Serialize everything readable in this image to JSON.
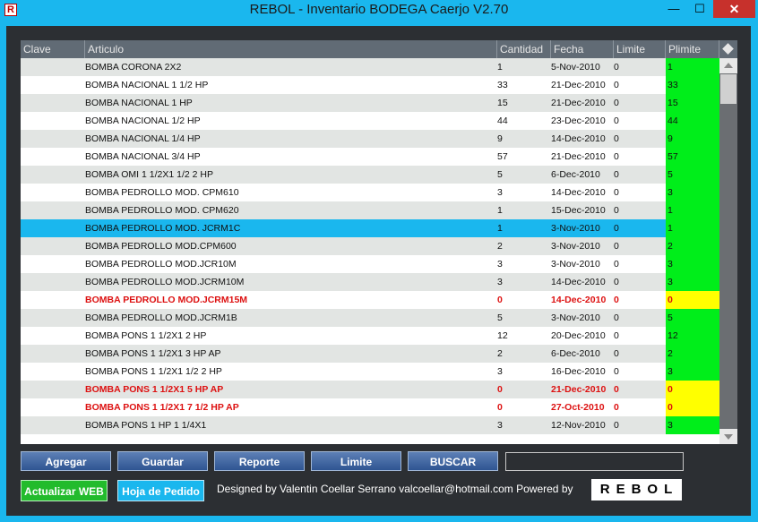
{
  "window": {
    "app_icon_letter": "R",
    "title": "REBOL - Inventario BODEGA Caerjo V2.70",
    "minimize_glyph": "—",
    "maximize_glyph": "☐",
    "close_glyph": "✕"
  },
  "grid": {
    "columns": [
      "Clave",
      "Articulo",
      "Cantidad",
      "Fecha",
      "Limite",
      "Plimite"
    ],
    "rows": [
      {
        "clave": "",
        "articulo": "BOMBA CORONA 2X2",
        "cantidad": "1",
        "fecha": "5-Nov-2010",
        "limite": "0",
        "plimite": "1",
        "status": "normal"
      },
      {
        "clave": "",
        "articulo": "BOMBA NACIONAL 1 1/2 HP",
        "cantidad": "33",
        "fecha": "21-Dec-2010",
        "limite": "0",
        "plimite": "33",
        "status": "normal"
      },
      {
        "clave": "",
        "articulo": "BOMBA NACIONAL 1 HP",
        "cantidad": "15",
        "fecha": "21-Dec-2010",
        "limite": "0",
        "plimite": "15",
        "status": "normal"
      },
      {
        "clave": "",
        "articulo": "BOMBA NACIONAL 1/2 HP",
        "cantidad": "44",
        "fecha": "23-Dec-2010",
        "limite": "0",
        "plimite": "44",
        "status": "normal"
      },
      {
        "clave": "",
        "articulo": "BOMBA NACIONAL 1/4 HP",
        "cantidad": "9",
        "fecha": "14-Dec-2010",
        "limite": "0",
        "plimite": "9",
        "status": "normal"
      },
      {
        "clave": "",
        "articulo": "BOMBA NACIONAL 3/4 HP",
        "cantidad": "57",
        "fecha": "21-Dec-2010",
        "limite": "0",
        "plimite": "57",
        "status": "normal"
      },
      {
        "clave": "",
        "articulo": "BOMBA OMI 1 1/2X1 1/2 2 HP",
        "cantidad": "5",
        "fecha": "6-Dec-2010",
        "limite": "0",
        "plimite": "5",
        "status": "normal"
      },
      {
        "clave": "",
        "articulo": "BOMBA PEDROLLO MOD. CPM610",
        "cantidad": "3",
        "fecha": "14-Dec-2010",
        "limite": "0",
        "plimite": "3",
        "status": "normal"
      },
      {
        "clave": "",
        "articulo": "BOMBA PEDROLLO MOD. CPM620",
        "cantidad": "1",
        "fecha": "15-Dec-2010",
        "limite": "0",
        "plimite": "1",
        "status": "normal"
      },
      {
        "clave": "",
        "articulo": "BOMBA PEDROLLO MOD. JCRM1C",
        "cantidad": "1",
        "fecha": "3-Nov-2010",
        "limite": "0",
        "plimite": "1",
        "status": "selected"
      },
      {
        "clave": "",
        "articulo": "BOMBA PEDROLLO MOD.CPM600",
        "cantidad": "2",
        "fecha": "3-Nov-2010",
        "limite": "0",
        "plimite": "2",
        "status": "normal"
      },
      {
        "clave": "",
        "articulo": "BOMBA PEDROLLO MOD.JCR10M",
        "cantidad": "3",
        "fecha": "3-Nov-2010",
        "limite": "0",
        "plimite": "3",
        "status": "normal"
      },
      {
        "clave": "",
        "articulo": "BOMBA PEDROLLO MOD.JCRM10M",
        "cantidad": "3",
        "fecha": "14-Dec-2010",
        "limite": "0",
        "plimite": "3",
        "status": "normal"
      },
      {
        "clave": "",
        "articulo": "BOMBA PEDROLLO MOD.JCRM15M",
        "cantidad": "0",
        "fecha": "14-Dec-2010",
        "limite": "0",
        "plimite": "0",
        "status": "alert"
      },
      {
        "clave": "",
        "articulo": "BOMBA PEDROLLO MOD.JCRM1B",
        "cantidad": "5",
        "fecha": "3-Nov-2010",
        "limite": "0",
        "plimite": "5",
        "status": "normal"
      },
      {
        "clave": "",
        "articulo": "BOMBA PONS 1 1/2X1    2 HP",
        "cantidad": "12",
        "fecha": "20-Dec-2010",
        "limite": "0",
        "plimite": "12",
        "status": "normal"
      },
      {
        "clave": "",
        "articulo": "BOMBA PONS 1 1/2X1    3 HP AP",
        "cantidad": "2",
        "fecha": "6-Dec-2010",
        "limite": "0",
        "plimite": "2",
        "status": "normal"
      },
      {
        "clave": "",
        "articulo": "BOMBA PONS 1 1/2X1 1/2    2 HP",
        "cantidad": "3",
        "fecha": "16-Dec-2010",
        "limite": "0",
        "plimite": "3",
        "status": "normal"
      },
      {
        "clave": "",
        "articulo": "BOMBA PONS 1 1/2X1 5 HP AP",
        "cantidad": "0",
        "fecha": "21-Dec-2010",
        "limite": "0",
        "plimite": "0",
        "status": "alert"
      },
      {
        "clave": "",
        "articulo": "BOMBA PONS 1 1/2X1 7 1/2 HP AP",
        "cantidad": "0",
        "fecha": "27-Oct-2010",
        "limite": "0",
        "plimite": "0",
        "status": "alert"
      },
      {
        "clave": "",
        "articulo": "BOMBA PONS 1 HP 1 1/4X1",
        "cantidad": "3",
        "fecha": "12-Nov-2010",
        "limite": "0",
        "plimite": "3",
        "status": "normal"
      }
    ]
  },
  "buttons": {
    "agregar": "Agregar",
    "guardar": "Guardar",
    "reporte": "Reporte",
    "limite": "Limite",
    "buscar": "BUSCAR",
    "actualizar_web": "Actualizar WEB",
    "hoja_pedido": "Hoja de Pedido"
  },
  "search": {
    "value": ""
  },
  "footer": {
    "credits": "Designed by Valentin Coellar Serrano valcoellar@hotmail.com Powered by",
    "logo_text": "REBOL"
  },
  "colors": {
    "window_accent": "#1ab7ee",
    "background": "#2c2f33",
    "ok_fill": "#00ee1a",
    "alert_fill": "#ffff00",
    "alert_text": "#dd1111",
    "selected_row": "#1ab7ee"
  },
  "icons": [
    "app-icon",
    "minimize-icon",
    "maximize-icon",
    "close-icon",
    "corner-diamond-icon",
    "scroll-up-icon",
    "scroll-down-icon"
  ]
}
